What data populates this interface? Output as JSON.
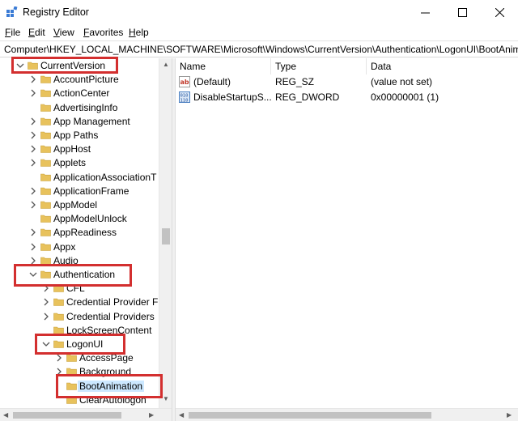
{
  "window": {
    "title": "Registry Editor"
  },
  "menu": {
    "file": "File",
    "edit": "Edit",
    "view": "View",
    "favorites": "Favorites",
    "help": "Help"
  },
  "address": {
    "path": "Computer\\HKEY_LOCAL_MACHINE\\SOFTWARE\\Microsoft\\Windows\\CurrentVersion\\Authentication\\LogonUI\\BootAnimation"
  },
  "tree": {
    "items": [
      {
        "label": "CurrentVersion",
        "expanded": true,
        "has_children": true
      },
      {
        "label": "AccountPicture",
        "expanded": false,
        "has_children": true
      },
      {
        "label": "ActionCenter",
        "expanded": false,
        "has_children": true
      },
      {
        "label": "AdvertisingInfo",
        "expanded": false,
        "has_children": false
      },
      {
        "label": "App Management",
        "expanded": false,
        "has_children": true
      },
      {
        "label": "App Paths",
        "expanded": false,
        "has_children": true
      },
      {
        "label": "AppHost",
        "expanded": false,
        "has_children": true
      },
      {
        "label": "Applets",
        "expanded": false,
        "has_children": true
      },
      {
        "label": "ApplicationAssociationT",
        "expanded": false,
        "has_children": false
      },
      {
        "label": "ApplicationFrame",
        "expanded": false,
        "has_children": true
      },
      {
        "label": "AppModel",
        "expanded": false,
        "has_children": true
      },
      {
        "label": "AppModelUnlock",
        "expanded": false,
        "has_children": false
      },
      {
        "label": "AppReadiness",
        "expanded": false,
        "has_children": true
      },
      {
        "label": "Appx",
        "expanded": false,
        "has_children": true
      },
      {
        "label": "Audio",
        "expanded": false,
        "has_children": true
      },
      {
        "label": "Authentication",
        "expanded": true,
        "has_children": true
      },
      {
        "label": "CFL",
        "expanded": false,
        "has_children": true
      },
      {
        "label": "Credential Provider Fi",
        "expanded": false,
        "has_children": true
      },
      {
        "label": "Credential Providers",
        "expanded": false,
        "has_children": true
      },
      {
        "label": "LockScreenContent",
        "expanded": false,
        "has_children": false
      },
      {
        "label": "LogonUI",
        "expanded": true,
        "has_children": true
      },
      {
        "label": "AccessPage",
        "expanded": false,
        "has_children": true
      },
      {
        "label": "Background",
        "expanded": false,
        "has_children": true
      },
      {
        "label": "BootAnimation",
        "expanded": false,
        "has_children": false,
        "selected": true
      },
      {
        "label": "ClearAutologon",
        "expanded": false,
        "has_children": false
      }
    ]
  },
  "list": {
    "columns": {
      "name": "Name",
      "type": "Type",
      "data": "Data"
    },
    "rows": [
      {
        "name": "(Default)",
        "type": "REG_SZ",
        "data": "(value not set)",
        "icon": "string-value-icon"
      },
      {
        "name": "DisableStartupS...",
        "type": "REG_DWORD",
        "data": "0x00000001 (1)",
        "icon": "binary-value-icon"
      }
    ]
  },
  "colors": {
    "highlight": "#d32f2f",
    "folder": "#e8c25c",
    "selection": "#cce8ff"
  }
}
